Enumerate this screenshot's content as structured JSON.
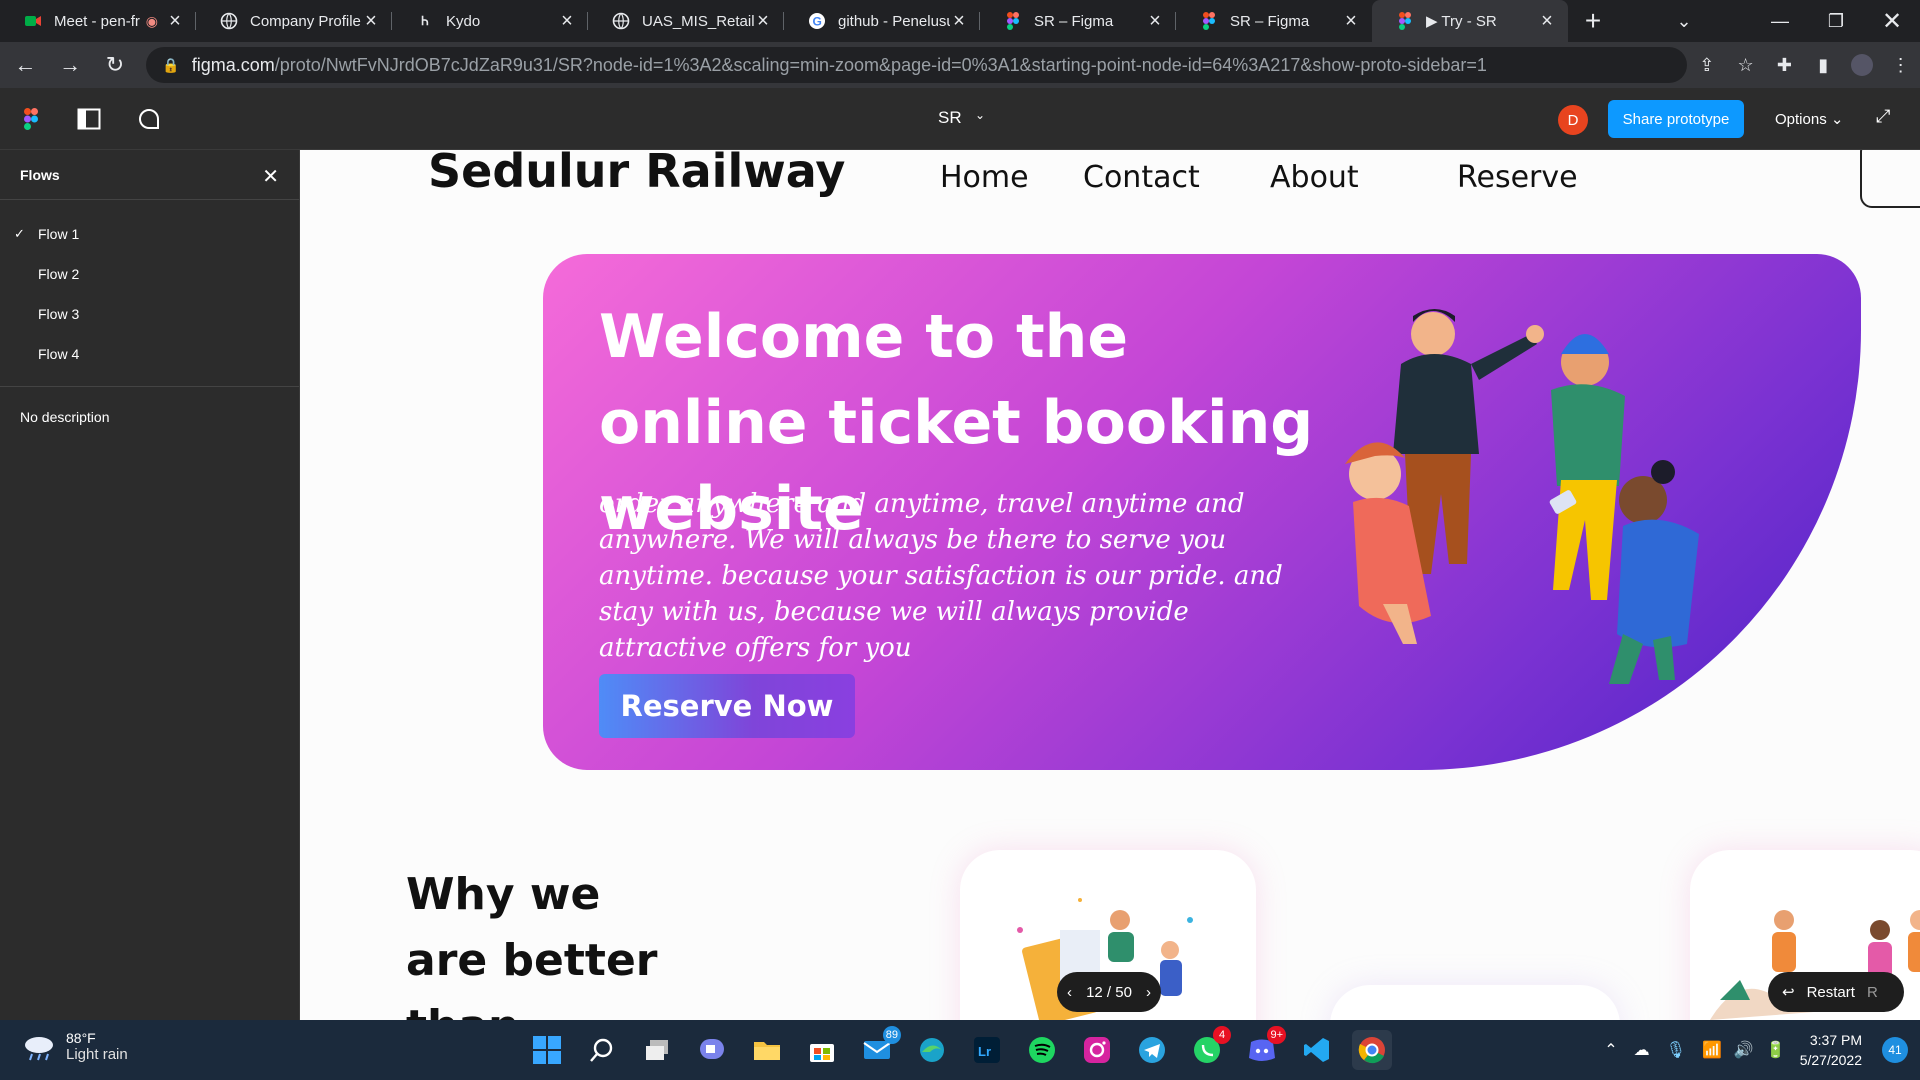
{
  "browser": {
    "tabs": [
      {
        "title": "Meet - pen-fr",
        "icon": "google-meet-icon",
        "active": false
      },
      {
        "title": "Company Profile",
        "icon": "globe-icon",
        "active": false
      },
      {
        "title": "Kydo",
        "icon": "kydo-icon",
        "active": false
      },
      {
        "title": "UAS_MIS_Retail-M",
        "icon": "globe-icon",
        "active": false
      },
      {
        "title": "github - Penelusu",
        "icon": "google-icon",
        "active": false
      },
      {
        "title": "SR – Figma",
        "icon": "figma-icon",
        "active": false
      },
      {
        "title": "SR – Figma",
        "icon": "figma-icon",
        "active": false
      },
      {
        "title": "▶ Try - SR",
        "icon": "figma-icon",
        "active": true
      }
    ],
    "url_host": "figma.com",
    "url_path": "/proto/NwtFvNJrdOB7cJdZaR9u31/SR?node-id=1%3A2&scaling=min-zoom&page-id=0%3A1&starting-point-node-id=64%3A217&show-proto-sidebar=1"
  },
  "figma": {
    "file_name": "SR",
    "avatar_initial": "D",
    "share_label": "Share prototype",
    "options_label": "Options"
  },
  "sidebar": {
    "title": "Flows",
    "flows": [
      {
        "label": "Flow 1",
        "selected": true
      },
      {
        "label": "Flow 2",
        "selected": false
      },
      {
        "label": "Flow 3",
        "selected": false
      },
      {
        "label": "Flow 4",
        "selected": false
      }
    ],
    "description": "No description"
  },
  "site": {
    "brand": "Sedulur Railway",
    "nav": [
      "Home",
      "Contact",
      "About",
      "Reserve"
    ],
    "hero_title": "Welcome to the online ticket booking website",
    "hero_text": "order anywhere and anytime, travel anytime and anywhere. We will always be there to serve you anytime. because your satisfaction is our pride. and stay with us, because we will always provide attractive offers for you",
    "hero_button": "Reserve Now",
    "section_title": "Why we are better than others"
  },
  "proto_controls": {
    "pager": "12 / 50",
    "restart_label": "Restart",
    "restart_key": "R"
  },
  "taskbar": {
    "temperature": "88°F",
    "condition": "Light rain",
    "time": "3:37 PM",
    "date": "5/27/2022",
    "notifications": "41",
    "badges": {
      "mail": "89",
      "whatsapp": "4",
      "discord": "9+"
    }
  }
}
